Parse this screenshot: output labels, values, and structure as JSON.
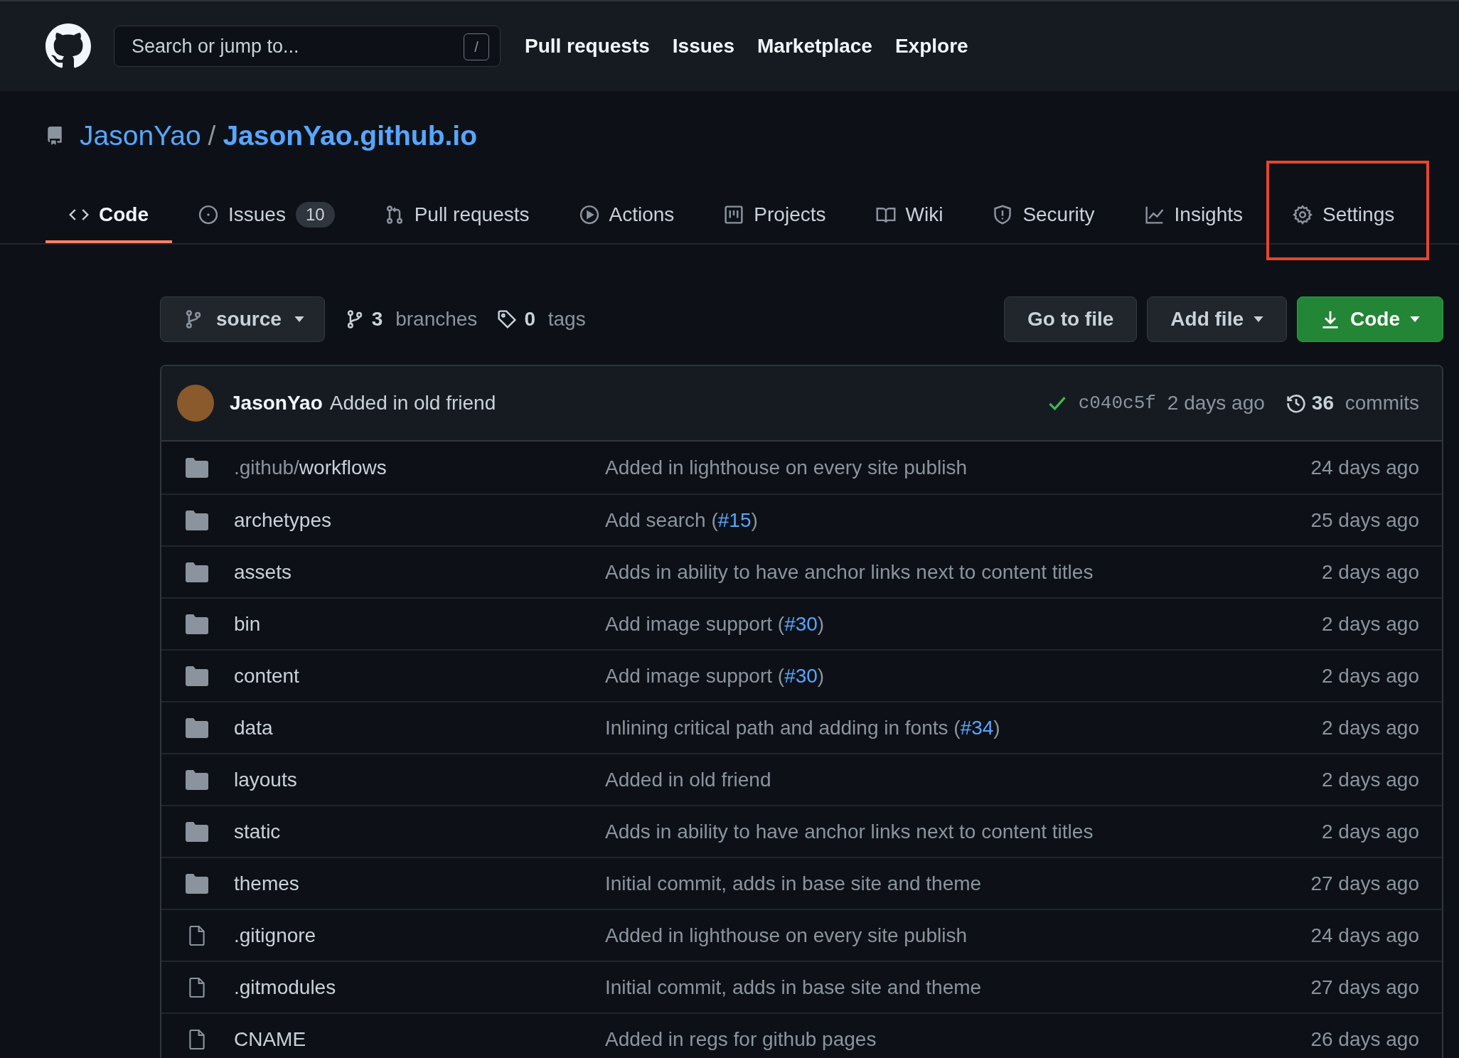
{
  "header": {
    "search": {
      "placeholder": "Search or jump to...",
      "shortcut": "/"
    },
    "nav": [
      "Pull requests",
      "Issues",
      "Marketplace",
      "Explore"
    ]
  },
  "repo": {
    "owner": "JasonYao",
    "separator": "/",
    "name": "JasonYao.github.io"
  },
  "tabs": [
    {
      "kind": "code",
      "label": "Code",
      "selected": true,
      "highlighted": false
    },
    {
      "kind": "issues",
      "label": "Issues",
      "counter": "10",
      "selected": false,
      "highlighted": false
    },
    {
      "kind": "pulls",
      "label": "Pull requests",
      "selected": false,
      "highlighted": false
    },
    {
      "kind": "actions",
      "label": "Actions",
      "selected": false,
      "highlighted": false
    },
    {
      "kind": "projects",
      "label": "Projects",
      "selected": false,
      "highlighted": false
    },
    {
      "kind": "wiki",
      "label": "Wiki",
      "selected": false,
      "highlighted": false
    },
    {
      "kind": "security",
      "label": "Security",
      "selected": false,
      "highlighted": false
    },
    {
      "kind": "insights",
      "label": "Insights",
      "selected": false,
      "highlighted": false
    },
    {
      "kind": "settings",
      "label": "Settings",
      "selected": false,
      "highlighted": true
    }
  ],
  "toolbar": {
    "branch": "source",
    "branches_count": "3",
    "branches_label": "branches",
    "tags_count": "0",
    "tags_label": "tags",
    "go_to_file": "Go to file",
    "add_file": "Add file",
    "code": "Code"
  },
  "commit": {
    "author": "JasonYao",
    "message": "Added in old friend",
    "checks_passed": true,
    "sha": "c040c5f",
    "time": "2 days ago",
    "commits_count": "36",
    "commits_label": "commits"
  },
  "files": [
    {
      "kind": "dir",
      "prefix": ".github/",
      "name": "workflows",
      "message": "Added in lighthouse on every site publish",
      "time": "24 days ago"
    },
    {
      "kind": "dir",
      "name": "archetypes",
      "message": "Add search (",
      "link": "#15",
      "message_end": ")",
      "time": "25 days ago"
    },
    {
      "kind": "dir",
      "name": "assets",
      "message": "Adds in ability to have anchor links next to content titles",
      "time": "2 days ago"
    },
    {
      "kind": "dir",
      "name": "bin",
      "message": "Add image support (",
      "link": "#30",
      "message_end": ")",
      "time": "2 days ago"
    },
    {
      "kind": "dir",
      "name": "content",
      "message": "Add image support (",
      "link": "#30",
      "message_end": ")",
      "time": "2 days ago"
    },
    {
      "kind": "dir",
      "name": "data",
      "message": "Inlining critical path and adding in fonts (",
      "link": "#34",
      "message_end": ")",
      "time": "2 days ago"
    },
    {
      "kind": "dir",
      "name": "layouts",
      "message": "Added in old friend",
      "time": "2 days ago"
    },
    {
      "kind": "dir",
      "name": "static",
      "message": "Adds in ability to have anchor links next to content titles",
      "time": "2 days ago"
    },
    {
      "kind": "dir",
      "name": "themes",
      "message": "Initial commit, adds in base site and theme",
      "time": "27 days ago"
    },
    {
      "kind": "file",
      "name": ".gitignore",
      "message": "Added in lighthouse on every site publish",
      "time": "24 days ago"
    },
    {
      "kind": "file",
      "name": ".gitmodules",
      "message": "Initial commit, adds in base site and theme",
      "time": "27 days ago"
    },
    {
      "kind": "file",
      "name": "CNAME",
      "message": "Added in regs for github pages",
      "time": "26 days ago"
    }
  ]
}
